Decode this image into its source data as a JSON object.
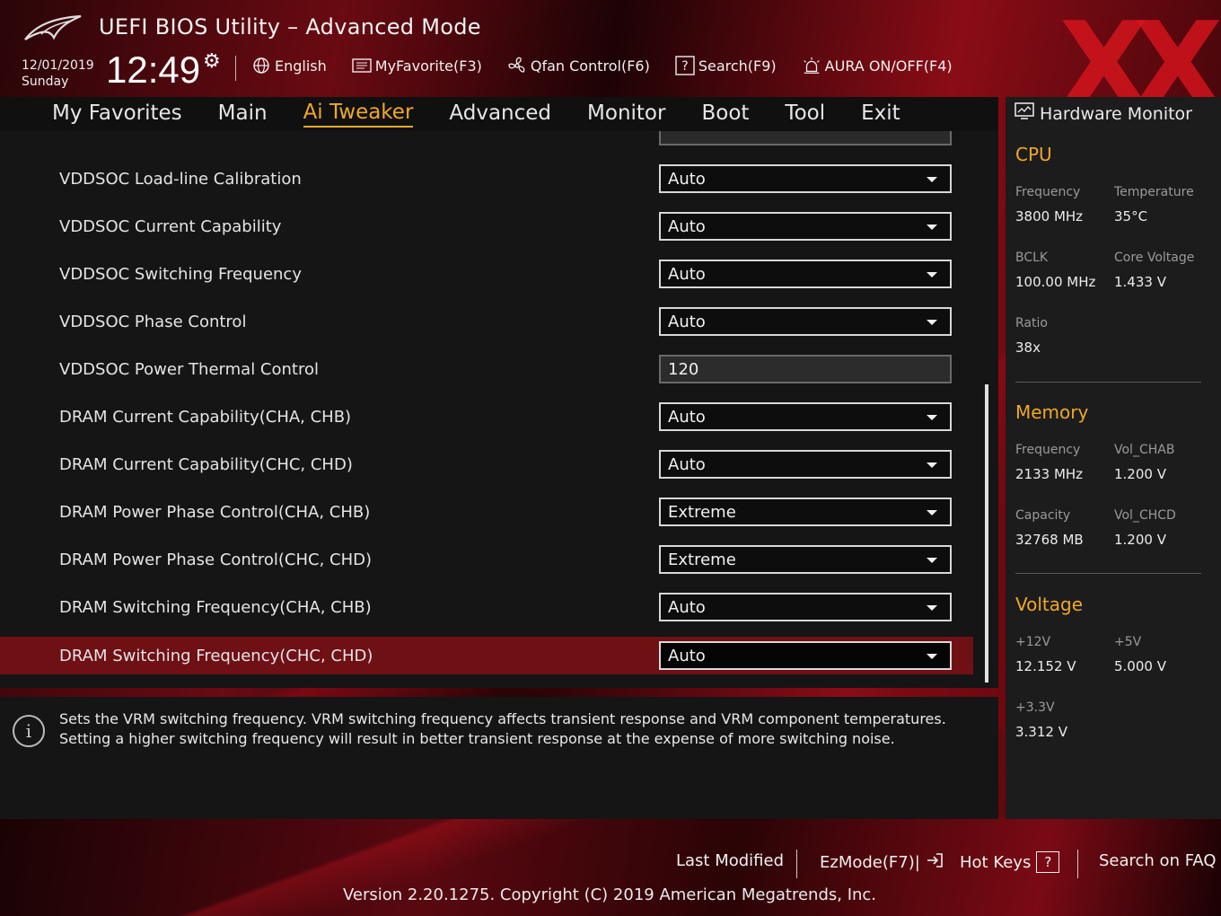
{
  "header": {
    "title": "UEFI BIOS Utility – Advanced Mode",
    "date": "12/01/2019",
    "day": "Sunday",
    "time": "12:49",
    "toolbar": [
      {
        "label": "English",
        "icon": "globe-icon"
      },
      {
        "label": "MyFavorite(F3)",
        "icon": "favorite-list-icon"
      },
      {
        "label": "Qfan Control(F6)",
        "icon": "fan-icon"
      },
      {
        "label": "Search(F9)",
        "icon": "search-help-icon"
      },
      {
        "label": "AURA ON/OFF(F4)",
        "icon": "aura-light-icon"
      }
    ],
    "watermark": "XX"
  },
  "menu": {
    "items": [
      "My Favorites",
      "Main",
      "Ai Tweaker",
      "Advanced",
      "Monitor",
      "Boot",
      "Tool",
      "Exit"
    ],
    "active": "Ai Tweaker"
  },
  "settings": [
    {
      "label": "VDDSOC Load-line Calibration",
      "value": "Auto",
      "type": "dropdown"
    },
    {
      "label": "VDDSOC Current Capability",
      "value": "Auto",
      "type": "dropdown"
    },
    {
      "label": "VDDSOC Switching Frequency",
      "value": "Auto",
      "type": "dropdown"
    },
    {
      "label": "VDDSOC Phase Control",
      "value": "Auto",
      "type": "dropdown"
    },
    {
      "label": "VDDSOC Power Thermal Control",
      "value": "120",
      "type": "number"
    },
    {
      "label": "DRAM Current Capability(CHA, CHB)",
      "value": "Auto",
      "type": "dropdown"
    },
    {
      "label": "DRAM Current Capability(CHC, CHD)",
      "value": "Auto",
      "type": "dropdown"
    },
    {
      "label": "DRAM Power Phase Control(CHA, CHB)",
      "value": "Extreme",
      "type": "dropdown"
    },
    {
      "label": "DRAM Power Phase Control(CHC, CHD)",
      "value": "Extreme",
      "type": "dropdown"
    },
    {
      "label": "DRAM Switching Frequency(CHA, CHB)",
      "value": "Auto",
      "type": "dropdown"
    },
    {
      "label": "DRAM Switching Frequency(CHC, CHD)",
      "value": "Auto",
      "type": "dropdown",
      "selected": true
    }
  ],
  "info": {
    "text": "Sets the VRM switching frequency.  VRM switching frequency affects transient response and VRM component temperatures. Setting a higher switching frequency will result in better transient response at the expense of more switching noise."
  },
  "hw_monitor": {
    "title": "Hardware Monitor",
    "cpu": {
      "heading": "CPU",
      "frequency_label": "Frequency",
      "frequency": "3800 MHz",
      "temperature_label": "Temperature",
      "temperature": "35°C",
      "bclk_label": "BCLK",
      "bclk": "100.00 MHz",
      "core_voltage_label": "Core Voltage",
      "core_voltage": "1.433 V",
      "ratio_label": "Ratio",
      "ratio": "38x"
    },
    "memory": {
      "heading": "Memory",
      "frequency_label": "Frequency",
      "frequency": "2133 MHz",
      "vol_chab_label": "Vol_CHAB",
      "vol_chab": "1.200 V",
      "capacity_label": "Capacity",
      "capacity": "32768 MB",
      "vol_chcd_label": "Vol_CHCD",
      "vol_chcd": "1.200 V"
    },
    "voltage": {
      "heading": "Voltage",
      "v12_label": "+12V",
      "v12": "12.152 V",
      "v5_label": "+5V",
      "v5": "5.000 V",
      "v33_label": "+3.3V",
      "v33": "3.312 V"
    }
  },
  "footer": {
    "last_modified": "Last Modified",
    "ezmode": "EzMode(F7)|",
    "hotkeys": "Hot Keys",
    "hotkeys_key": "?",
    "faq": "Search on FAQ",
    "version": "Version 2.20.1275. Copyright (C) 2019 American Megatrends, Inc."
  },
  "colors": {
    "accent": "#f0a828",
    "selected_row": "#6e1014",
    "brand_red": "#c8141e"
  }
}
